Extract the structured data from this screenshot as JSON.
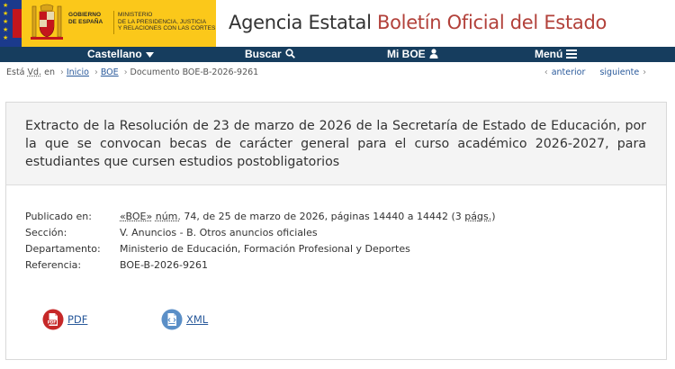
{
  "header": {
    "gov_label_line1": "GOBIERNO",
    "gov_label_line2": "DE ESPAÑA",
    "ministry_line1": "MINISTERIO",
    "ministry_line2": "DE LA PRESIDENCIA, JUSTICIA",
    "ministry_line3": "Y RELACIONES CON LAS CORTES",
    "site_title_plain": "Agencia Estatal",
    "site_title_accent": "Boletín Oficial del Estado"
  },
  "nav": {
    "language": "Castellano",
    "search": "Buscar",
    "my_boe": "Mi BOE",
    "menu": "Menú"
  },
  "breadcrumb": {
    "prefix_1": "Está",
    "prefix_abbr": "Vd.",
    "prefix_2": "en",
    "items": [
      "Inicio",
      "BOE",
      "Documento BOE-B-2026-9261"
    ]
  },
  "pager": {
    "previous": "anterior",
    "next": "siguiente"
  },
  "document": {
    "title": "Extracto de la Resolución de 23 de marzo de 2026 de la Secretaría de Estado de Educación, por la que se convocan becas de carácter general para el curso académico 2026-2027, para estudiantes que cursen estudios postobligatorios",
    "published_label": "Publicado en:",
    "published_boe": "«BOE»",
    "published_num_abbr": "núm.",
    "published_rest": "74, de 25 de marzo de 2026, páginas 14440 a 14442 (3",
    "published_pags_abbr": "págs.",
    "published_close": ")",
    "section_label": "Sección:",
    "section_value": "V. Anuncios - B. Otros anuncios oficiales",
    "department_label": "Departamento:",
    "department_value": "Ministerio de Educación, Formación Profesional y Deportes",
    "reference_label": "Referencia:",
    "reference_value": "BOE-B-2026-9261"
  },
  "downloads": {
    "pdf_label": "PDF",
    "xml_label": "XML",
    "pdf_icon_text": "PDF"
  },
  "colors": {
    "nav_bg": "#163d5e",
    "gov_yellow": "#fbc81a",
    "accent_red": "#b2413a",
    "link_blue": "#2a5a9b",
    "pdf_red": "#c62828",
    "xml_blue": "#5b8fc7"
  },
  "icons": {
    "language": "caret-down-icon",
    "search": "magnifier-icon",
    "my_boe": "user-icon",
    "menu": "hamburger-icon",
    "pdf": "pdf-file-icon",
    "xml": "xml-file-icon"
  }
}
